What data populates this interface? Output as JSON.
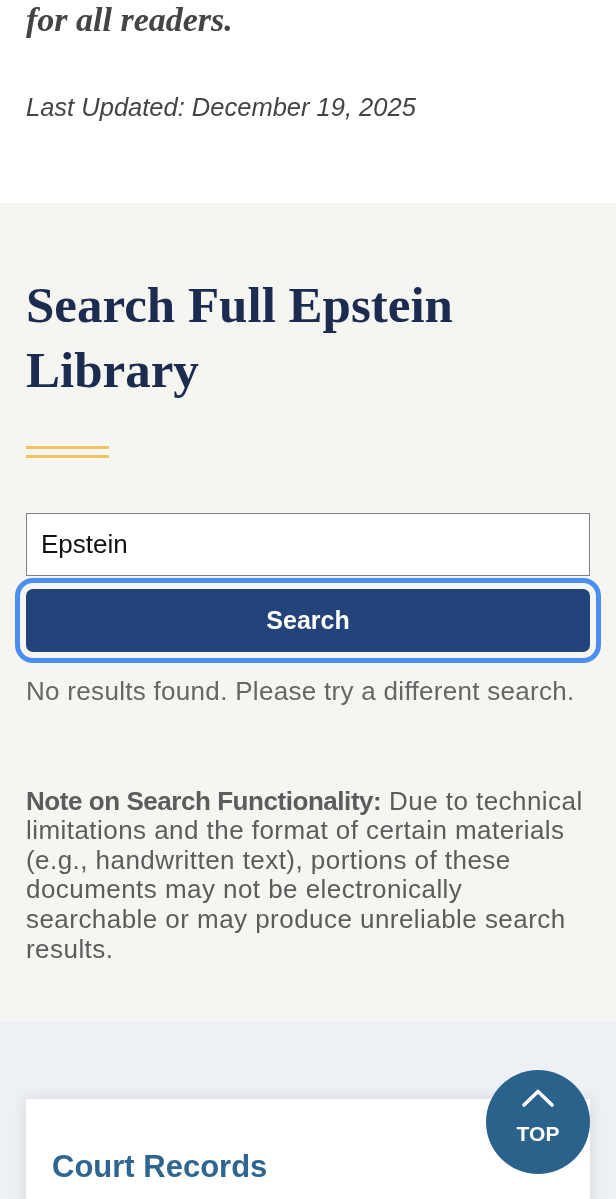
{
  "intro": {
    "text": "for all readers.",
    "last_updated": "Last Updated: December 19, 2025"
  },
  "search": {
    "title": "Search Full Epstein Library",
    "field": {
      "value": "Epstein"
    },
    "button": {
      "label": "Search",
      "focused": true
    },
    "message": "No results found. Please try a different search.",
    "note": "**Note on Search Functionality:** Due to technical limitations and the format of certain materials (e.g., handwritten text), portions of these documents may not be electronically searchable or may produce unreliable search results."
  },
  "records": {
    "title": "Court Records"
  },
  "back_to_top": {
    "label": "TOP"
  }
}
